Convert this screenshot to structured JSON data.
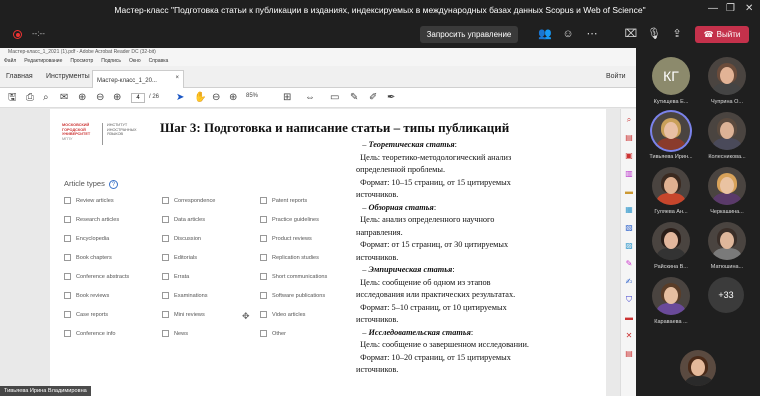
{
  "window_title": "Мастер-класс \"Подготовка статьи к публикации в изданиях, индексируемых в международных базах данных Scopus и Web of Science\"",
  "meeting": {
    "timer": "--:--",
    "request_control_label": "Запросить управление",
    "leave_label": "Выйти"
  },
  "acrobat": {
    "title": "Мастер-класс_1_2021 (1).pdf - Adobe Acrobat Reader DC (32-bit)",
    "menu": [
      "Файл",
      "Редактирование",
      "Просмотр",
      "Подпись",
      "Окно",
      "Справка"
    ],
    "tabs": {
      "home": "Главная",
      "tools": "Инструменты",
      "document": "Мастер-класс_1_20..."
    },
    "signin": "Войти",
    "page_current": "4",
    "page_total": "/ 26",
    "zoom": "85%"
  },
  "slide": {
    "logo_name": "МОСКОВСКИЙ ГОРОДСКОЙ УНИВЕРСИТЕТ",
    "logo_sub": "МГПУ",
    "logo_institute": "ИНСТИТУТ ИНОСТРАННЫХ ЯЗЫКОВ",
    "title": "Шаг 3: Подготовка и написание статьи – типы публикаций",
    "article_types_title": "Article types",
    "article_types": [
      [
        "Review articles",
        "Correspondence",
        "Patent reports"
      ],
      [
        "Research articles",
        "Data articles",
        "Practice guidelines"
      ],
      [
        "Encyclopedia",
        "Discussion",
        "Product reviews"
      ],
      [
        "Book chapters",
        "Editorials",
        "Replication studies"
      ],
      [
        "Conference abstracts",
        "Errata",
        "Short communications"
      ],
      [
        "Book reviews",
        "Examinations",
        "Software publications"
      ],
      [
        "Case reports",
        "Mini reviews",
        "Video articles"
      ],
      [
        "Conference info",
        "News",
        "Other"
      ]
    ],
    "text": {
      "t1": "Теоретическая статья",
      "t1_goal": "Цель: теоретико-методологический анализ",
      "t1_goal2": "определенной проблемы.",
      "t1_format": "Формат: 10–15 страниц, от 15 цитируемых",
      "t1_format2": "источников.",
      "t2": "Обзорная статья",
      "t2_goal": "Цель: анализ определенного научного",
      "t2_goal2": "направления.",
      "t2_format": "Формат: от 15 страниц, от 30 цитируемых",
      "t2_format2": "источников.",
      "t3": "Эмпирическая статья",
      "t3_goal": "Цель: сообщение об одном из этапов",
      "t3_goal2": "исследования или практических результатах.",
      "t3_format": "Формат: 5–10 страниц, от 10 цитируемых",
      "t3_format2": "источников.",
      "t4": "Исследовательская статья",
      "t4_goal": "Цель: сообщение о завершенном исследовании.",
      "t4_format": "Формат: 10–20 страниц, от 15 цитируемых",
      "t4_format2": "источников."
    }
  },
  "speaker_name": "Тивьяева Ирина Владимировна",
  "participants": [
    {
      "name": "Кутищева Е...",
      "initials": "КГ"
    },
    {
      "name": "Чуприна О..."
    },
    {
      "name": "Тивьяева Ирин..."
    },
    {
      "name": "Колесникова..."
    },
    {
      "name": "Гуляева Ан..."
    },
    {
      "name": "Черкашина..."
    },
    {
      "name": "Райскина В..."
    },
    {
      "name": "Матюшина..."
    },
    {
      "name": "Караваева ..."
    }
  ],
  "more_count": "+33",
  "colors": {
    "leave": "#c4314b",
    "accent": "#3b73c8",
    "avatar_kg": "#8c8a6c"
  }
}
